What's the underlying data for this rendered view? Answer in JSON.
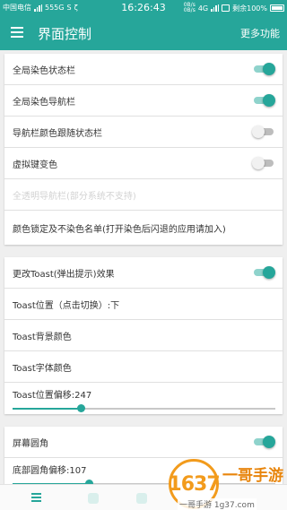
{
  "status_bar": {
    "carrier": "中国电信",
    "network": "555G",
    "network_extra": "S",
    "data_icon": "ζ",
    "time": "16:26:43",
    "speed_up": "0B/s",
    "speed_down": "0B/s",
    "net_type": "4G",
    "battery_label": "剩余100%",
    "battery_level": 100
  },
  "app_bar": {
    "title": "界面控制",
    "more_label": "更多功能"
  },
  "sections": [
    {
      "rows": [
        {
          "label": "全局染色状态栏",
          "switch_on": true
        },
        {
          "label": "全局染色导航栏",
          "switch_on": true
        },
        {
          "label": "导航栏颜色跟随状态栏",
          "switch_on": false
        },
        {
          "label": "虚拟键变色",
          "switch_on": false
        },
        {
          "label": "全透明导航栏(部分系统不支持)"
        },
        {
          "label": "颜色锁定及不染色名单(打开染色后闪退的应用请加入)"
        }
      ]
    },
    {
      "rows": [
        {
          "label": "更改Toast(弹出提示)效果",
          "switch_on": true
        },
        {
          "label": "Toast位置（点击切换）:下"
        },
        {
          "label": "Toast背景颜色"
        },
        {
          "label": "Toast字体颜色"
        },
        {
          "label": "Toast位置偏移:247",
          "slider_value": 0.26
        }
      ]
    },
    {
      "rows": [
        {
          "label": "屏幕圆角",
          "switch_on": true
        },
        {
          "label": "底部圆角偏移:107",
          "slider_value": 0.29
        }
      ]
    }
  ],
  "watermark": {
    "number": "1637",
    "name": "一哥手游",
    "url": "一哥手游 1g37.com"
  },
  "colors": {
    "accent": "#26a69a",
    "switch_on_track": "#8fd3cc",
    "switch_off_track": "#bdbdbd",
    "background": "#efefef",
    "watermark_orange": "#f29b1c"
  },
  "icons": {
    "menu": "menu-icon",
    "bottom_nav_first": "list-icon"
  }
}
